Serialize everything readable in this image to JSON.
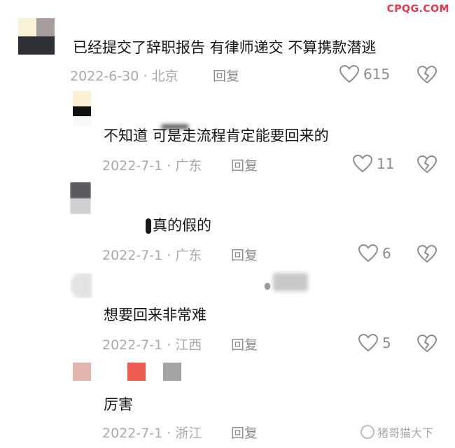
{
  "site_watermark": "CPQG.COM",
  "bottom_watermark": "猪哥猫大下",
  "reply_label": "回复",
  "comments": [
    {
      "text": "已经提交了辞职报告 有律师递交 不算携款潜逃",
      "date": "2022-6-30",
      "location": "北京",
      "likes": "615"
    },
    {
      "text": "不知道 可是走流程肯定能要回来的",
      "date": "2022-7-1",
      "location": "广东",
      "likes": "11"
    },
    {
      "text": "真的假的",
      "date": "2022-7-1",
      "location": "广东",
      "likes": "6"
    },
    {
      "text": "想要回来非常难",
      "date": "2022-7-1",
      "location": "江西",
      "likes": "5"
    },
    {
      "text": "厉害",
      "date": "2022-7-1",
      "location": "浙江",
      "likes": ""
    }
  ]
}
